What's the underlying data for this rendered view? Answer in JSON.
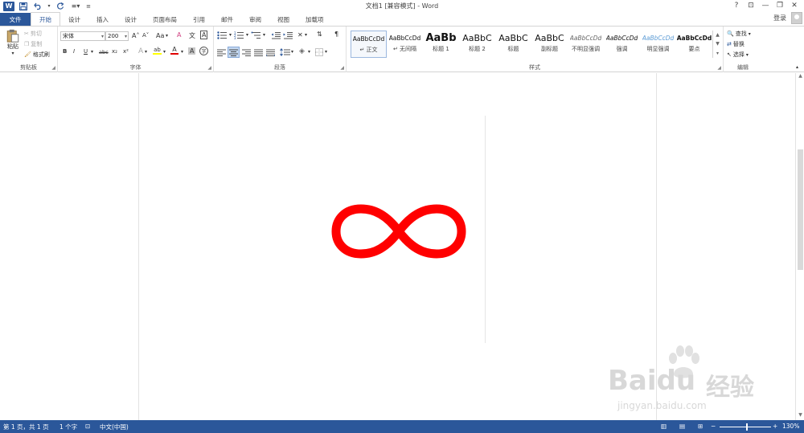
{
  "window": {
    "title": "文档1 [兼容模式] - Word",
    "controls": {
      "help": "?",
      "ribbon_options": "⊡",
      "minimize": "—",
      "restore": "❐",
      "close": "✕"
    }
  },
  "qat": {
    "word_logo": "W",
    "save": "💾",
    "undo": "↶",
    "undo_dd": "▾",
    "redo": "↺",
    "format": "≡▾",
    "customize": "≡"
  },
  "tabs": [
    "文件",
    "开始",
    "设计",
    "插入",
    "设计",
    "页面布局",
    "引用",
    "邮件",
    "审阅",
    "视图",
    "加载项"
  ],
  "active_tab": "开始",
  "account": {
    "login": "登录"
  },
  "clipboard": {
    "paste": "粘贴",
    "cut": "剪切",
    "copy": "复制",
    "format_painter": "格式刷",
    "label": "剪贴板"
  },
  "font": {
    "name": "宋体",
    "size": "200",
    "grow": "A˄",
    "shrink": "A˅",
    "case": "Aa",
    "clear": "A",
    "phonetic": "文",
    "border": "A",
    "bold": "B",
    "italic": "I",
    "underline": "U",
    "strike": "abc",
    "sub": "x₂",
    "sup": "x²",
    "effects": "A",
    "highlight": "ab",
    "color": "A",
    "shade": "A",
    "enclose": "字",
    "label": "字体",
    "font_color": "#e00000",
    "highlight_color": "#ffff00"
  },
  "paragraph": {
    "label": "段落"
  },
  "styles": {
    "label": "样式",
    "items": [
      {
        "preview": "AaBbCcDd",
        "name": "正文",
        "marker": "↵"
      },
      {
        "preview": "AaBbCcDd",
        "name": "无间隔",
        "marker": "↵"
      },
      {
        "preview": "AaBb",
        "name": "标题 1"
      },
      {
        "preview": "AaBbC",
        "name": "标题 2"
      },
      {
        "preview": "AaBbC",
        "name": "标题"
      },
      {
        "preview": "AaBbC",
        "name": "副标题"
      },
      {
        "preview": "AaBbCcDd",
        "name": "不明显强调"
      },
      {
        "preview": "AaBbCcDd",
        "name": "强调"
      },
      {
        "preview": "AaBbCcDd",
        "name": "明显强调"
      },
      {
        "preview": "AaBbCcDd",
        "name": "要点"
      }
    ]
  },
  "editing": {
    "find": "查找",
    "replace": "替换",
    "select": "选择",
    "label": "编辑"
  },
  "document": {
    "symbol_color": "#ff0000",
    "symbol_desc": "infinity"
  },
  "status": {
    "page": "第 1 页，共 1 页",
    "words": "1 个字",
    "language": "中文(中国)",
    "zoom": "130%"
  },
  "watermark": {
    "brand": "Baidu",
    "cn": "经验",
    "url": "jingyan.baidu.com"
  }
}
